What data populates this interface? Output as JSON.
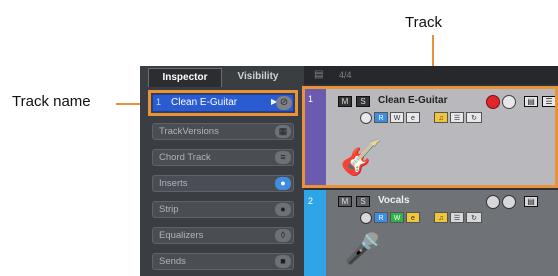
{
  "callouts": {
    "track": "Track",
    "track_name": "Track name"
  },
  "inspector": {
    "tabs": [
      "Inspector",
      "Visibility"
    ],
    "track_number": "1",
    "track_name": "Clean E-Guitar",
    "sections": [
      {
        "label": "TrackVersions",
        "icon": "grid"
      },
      {
        "label": "Chord Track",
        "icon": "list"
      },
      {
        "label": "Inserts",
        "icon": "plug"
      },
      {
        "label": "Strip",
        "icon": "plug"
      },
      {
        "label": "Equalizers",
        "icon": "eq"
      },
      {
        "label": "Sends",
        "icon": "send"
      }
    ]
  },
  "ruler": {
    "time_signature": "4/4"
  },
  "tracks": [
    {
      "number": "1",
      "name": "Clean E-Guitar",
      "color": "#6b5bb0",
      "selected": true,
      "instrument_icon": "guitar-icon"
    },
    {
      "number": "2",
      "name": "Vocals",
      "color": "#2fa4e6",
      "selected": false,
      "instrument_icon": "microphone-icon"
    }
  ],
  "colors": {
    "highlight": "#e8923a",
    "record": "#e0262b",
    "selected_track_bg": "#2a5bd0"
  }
}
